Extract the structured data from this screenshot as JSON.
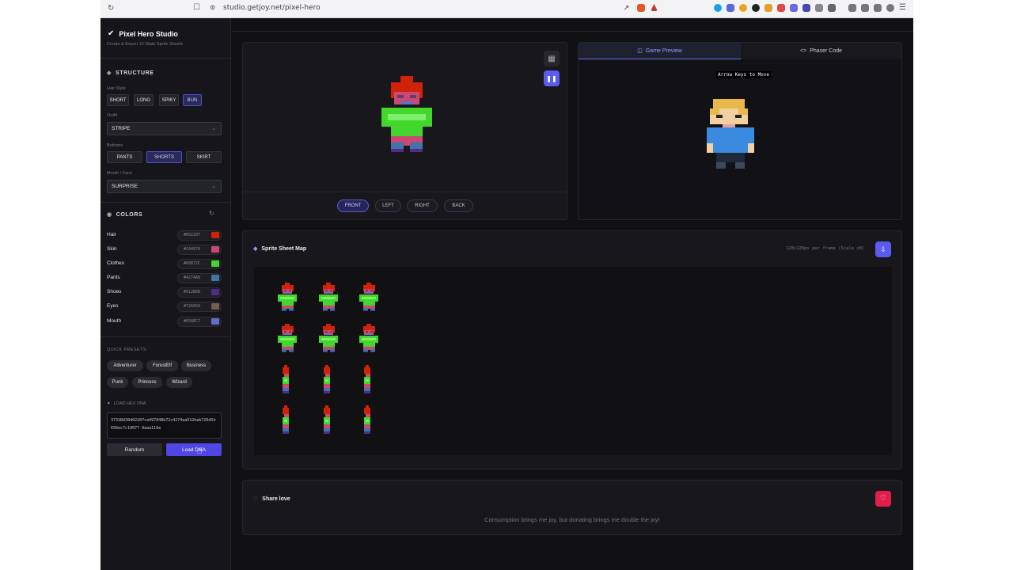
{
  "browser": {
    "url": "studio.getjoy.net/pixel-hero"
  },
  "app": {
    "title": "Pixel Hero Studio",
    "subtitle": "Create & Export 12-State Sprite Sheets"
  },
  "structure": {
    "title": "STRUCTURE",
    "hair_label": "Hair Style",
    "hair_options": [
      "SHORT",
      "LONG",
      "SPIKY",
      "BUN"
    ],
    "hair_selected": "BUN",
    "outfit_label": "Outfit",
    "outfit_value": "STRIPE",
    "bottoms_label": "Bottoms",
    "bottoms_options": [
      "PANTS",
      "SHORTS",
      "SKIRT"
    ],
    "bottoms_selected": "SHORTS",
    "mouth_label": "Mouth / Face",
    "mouth_value": "SURPRISE"
  },
  "colors": {
    "title": "COLORS",
    "items": [
      {
        "name": "Hair",
        "hex": "#D02207",
        "color": "#D02207"
      },
      {
        "name": "Skin",
        "hex": "#CA4970",
        "color": "#CA4970"
      },
      {
        "name": "Clothes",
        "hex": "#68872C",
        "color": "#43D62C"
      },
      {
        "name": "Pants",
        "hex": "#4274A8",
        "color": "#4274A8"
      },
      {
        "name": "Shoes",
        "hex": "#512B6B",
        "color": "#512B8B"
      },
      {
        "name": "Eyes",
        "hex": "#726050",
        "color": "#726050"
      },
      {
        "name": "Mouth",
        "hex": "#656EC7",
        "color": "#656EC7"
      }
    ]
  },
  "presets": {
    "title": "QUICK PRESETS",
    "items": [
      "Adventurer",
      "ForestElf",
      "Business",
      "Punk",
      "Princess",
      "Wizard"
    ]
  },
  "dna": {
    "title": "LOAD HEX DNA",
    "value": "3731Bd38d02207ca497848b72c4274aa512bab726d5b656ec7c19077 9aaa116e"
  },
  "actions": {
    "random": "Random",
    "load": "Load DNA"
  },
  "preview": {
    "directions": [
      "FRONT",
      "LEFT",
      "RIGHT",
      "BACK"
    ],
    "selected": "FRONT"
  },
  "game": {
    "tab_preview": "Game Preview",
    "tab_code": "Phaser Code",
    "hint": "Arrow Keys to Move"
  },
  "sheet": {
    "title": "Sprite Sheet Map",
    "meta": "128x128px per frame (Scale x8)"
  },
  "share": {
    "title": "Share love",
    "message": "Consumption brings me joy, but donating brings me double the joy!"
  }
}
